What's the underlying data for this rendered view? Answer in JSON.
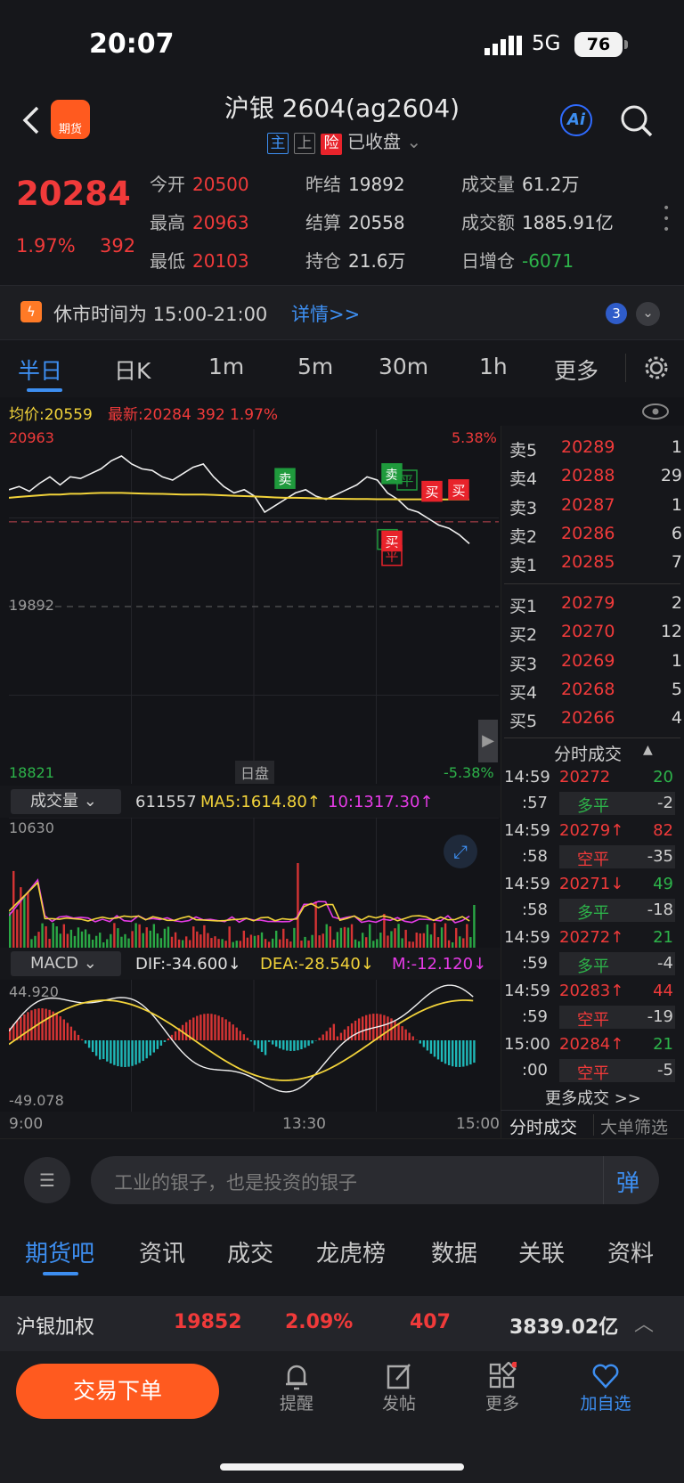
{
  "status": {
    "time": "20:07",
    "network": "5G",
    "battery": "76"
  },
  "header": {
    "title": "沪银 2604(ag2604)",
    "tag_main": "主",
    "tag_up": "上",
    "tag_risk": "险",
    "market_state": "已收盘",
    "logo_text": "期货"
  },
  "quote": {
    "last": "20284",
    "pct": "1.97%",
    "change": "392",
    "open_label": "今开",
    "open": "20500",
    "high_label": "最高",
    "high": "20963",
    "low_label": "最低",
    "low": "20103",
    "prev_settle_label": "昨结",
    "prev_settle": "19892",
    "settle_label": "结算",
    "settle": "20558",
    "oi_label": "持仓",
    "oi": "21.6万",
    "vol_label": "成交量",
    "vol": "61.2万",
    "turnover_label": "成交额",
    "turnover": "1885.91亿",
    "oi_change_label": "日增仓",
    "oi_change": "-6071"
  },
  "notice": {
    "text": "休市时间为 15:00-21:00",
    "link": "详情>>",
    "badge": "3"
  },
  "tabs": [
    "半日",
    "日K",
    "1m",
    "5m",
    "30m",
    "1h",
    "更多"
  ],
  "chart_info": {
    "avg": "均价:20559",
    "latest": "最新:20284 392 1.97%"
  },
  "chart_data": {
    "type": "line",
    "y_top": "20963",
    "y_mid": "19892",
    "y_bottom": "18821",
    "pct_top": "5.38%",
    "pct_bottom": "-5.38%",
    "ylim": [
      18821,
      20963
    ],
    "x_labels": [
      "9:00",
      "13:30",
      "15:00"
    ],
    "session_label": "日盘",
    "series": [
      {
        "values": [
          20620,
          20640,
          20610,
          20660,
          20700,
          20650,
          20700,
          20690,
          20720,
          20750,
          20800,
          20830,
          20780,
          20750,
          20740,
          20700,
          20680,
          20720,
          20760,
          20780,
          20700,
          20640,
          20600,
          20620,
          20580,
          20480,
          20520,
          20560,
          20600,
          20620,
          20580,
          20560,
          20590,
          20620,
          20650,
          20700,
          20680,
          20600,
          20560,
          20500,
          20480,
          20440,
          20400,
          20380,
          20340,
          20284
        ]
      },
      {
        "values": [
          20570,
          20575,
          20580,
          20585,
          20590,
          20590,
          20595,
          20595,
          20598,
          20600,
          20600,
          20600,
          20598,
          20596,
          20595,
          20594,
          20592,
          20590,
          20590,
          20590,
          20588,
          20585,
          20582,
          20580,
          20578,
          20575,
          20572,
          20570,
          20570,
          20568,
          20566,
          20565,
          20564,
          20563,
          20562,
          20562,
          20561,
          20561,
          20560,
          20560,
          20560,
          20560,
          20559,
          20559,
          20559,
          20559
        ]
      }
    ],
    "markers": [
      "卖",
      "卖",
      "平",
      "买",
      "买",
      "平",
      "买",
      "平"
    ]
  },
  "volume": {
    "label": "成交量",
    "value": "611557",
    "ma5": "MA5:1614.80↑",
    "ma10": "10:1317.30↑",
    "top": "10630"
  },
  "macd": {
    "label": "MACD",
    "dif": "DIF:-34.600↓",
    "dea": "DEA:-28.540↓",
    "m": "M:-12.120↓",
    "top": "44.920",
    "bottom": "-49.078"
  },
  "orderbook": {
    "asks": [
      {
        "l": "卖5",
        "p": "20289",
        "v": "1"
      },
      {
        "l": "卖4",
        "p": "20288",
        "v": "29"
      },
      {
        "l": "卖3",
        "p": "20287",
        "v": "1"
      },
      {
        "l": "卖2",
        "p": "20286",
        "v": "6"
      },
      {
        "l": "卖1",
        "p": "20285",
        "v": "7"
      }
    ],
    "bids": [
      {
        "l": "买1",
        "p": "20279",
        "v": "2"
      },
      {
        "l": "买2",
        "p": "20270",
        "v": "12"
      },
      {
        "l": "买3",
        "p": "20269",
        "v": "1"
      },
      {
        "l": "买4",
        "p": "20268",
        "v": "5"
      },
      {
        "l": "买5",
        "p": "20266",
        "v": "4"
      }
    ]
  },
  "ticks": {
    "title": "分时成交",
    "rows": [
      {
        "t": "14:59",
        "p": "20272",
        "v": "20",
        "s": ":57",
        "k": "多平",
        "d": "-2"
      },
      {
        "t": "14:59",
        "p": "20279↑",
        "v": "82",
        "s": ":58",
        "k": "空平",
        "d": "-35"
      },
      {
        "t": "14:59",
        "p": "20271↓",
        "v": "49",
        "s": ":58",
        "k": "多平",
        "d": "-18"
      },
      {
        "t": "14:59",
        "p": "20272↑",
        "v": "21",
        "s": ":59",
        "k": "多平",
        "d": "-4"
      },
      {
        "t": "14:59",
        "p": "20283↑",
        "v": "44",
        "s": ":59",
        "k": "空平",
        "d": "-19"
      },
      {
        "t": "15:00",
        "p": "20284↑",
        "v": "21",
        "s": ":00",
        "k": "空平",
        "d": "-5"
      }
    ],
    "more": "更多成交 >>",
    "tab1": "分时成交",
    "tab2": "大单筛选"
  },
  "input": {
    "placeholder": "工业的银子，也是投资的银子",
    "danmu": "弹"
  },
  "bottom_tabs": [
    "期货吧",
    "资讯",
    "成交",
    "龙虎榜",
    "数据",
    "关联",
    "资料"
  ],
  "weighted": {
    "name": "沪银加权",
    "price": "19852",
    "pct": "2.09%",
    "chg": "407",
    "amount": "3839.02亿"
  },
  "nav": {
    "trade": "交易下单",
    "remind": "提醒",
    "post": "发帖",
    "more": "更多",
    "fav": "加自选"
  }
}
